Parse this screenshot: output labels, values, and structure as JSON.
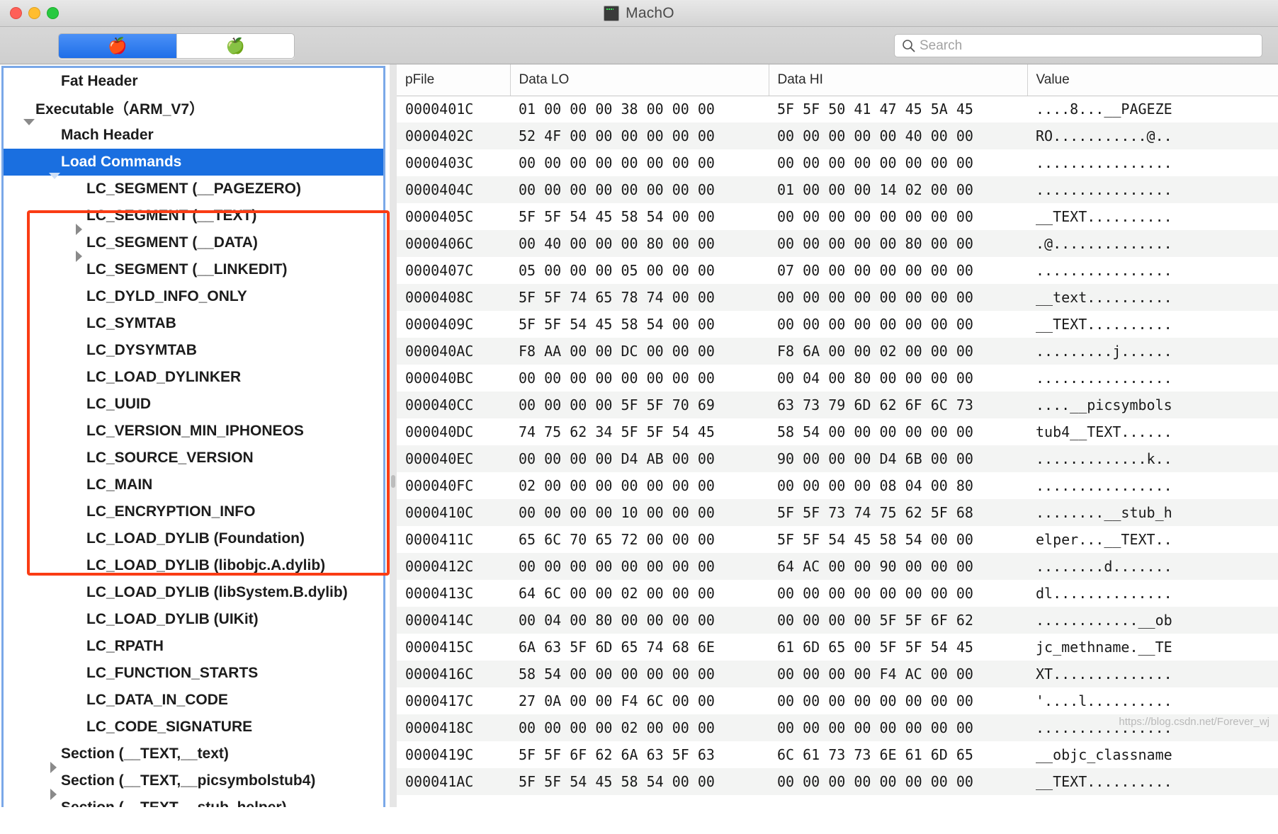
{
  "window": {
    "title": "MachO",
    "app_icon": "terminal-icon",
    "traffic_lights": [
      "close",
      "minimize",
      "zoom"
    ]
  },
  "toolbar": {
    "segments": [
      {
        "icon": "apple-bitten-red-icon",
        "selected": true
      },
      {
        "icon": "apple-bitten-grey-icon",
        "selected": false
      }
    ],
    "search": {
      "placeholder": "Search",
      "value": "",
      "icon": "search-icon"
    }
  },
  "sidebar": {
    "items": [
      {
        "label": "Fat Header",
        "indent": 1,
        "arrow": "none",
        "selected": false
      },
      {
        "label": "Executable（ARM_V7）",
        "indent": 0,
        "arrow": "down",
        "selected": false
      },
      {
        "label": "Mach Header",
        "indent": 1,
        "arrow": "none",
        "selected": false
      },
      {
        "label": "Load Commands",
        "indent": 1,
        "arrow": "down",
        "selected": true
      },
      {
        "label": "LC_SEGMENT (__PAGEZERO)",
        "indent": 2,
        "arrow": "none",
        "selected": false
      },
      {
        "label": "LC_SEGMENT (__TEXT)",
        "indent": 2,
        "arrow": "right",
        "selected": false
      },
      {
        "label": "LC_SEGMENT (__DATA)",
        "indent": 2,
        "arrow": "right",
        "selected": false
      },
      {
        "label": "LC_SEGMENT (__LINKEDIT)",
        "indent": 2,
        "arrow": "none",
        "selected": false
      },
      {
        "label": "LC_DYLD_INFO_ONLY",
        "indent": 2,
        "arrow": "none",
        "selected": false
      },
      {
        "label": "LC_SYMTAB",
        "indent": 2,
        "arrow": "none",
        "selected": false
      },
      {
        "label": "LC_DYSYMTAB",
        "indent": 2,
        "arrow": "none",
        "selected": false
      },
      {
        "label": "LC_LOAD_DYLINKER",
        "indent": 2,
        "arrow": "none",
        "selected": false
      },
      {
        "label": "LC_UUID",
        "indent": 2,
        "arrow": "none",
        "selected": false
      },
      {
        "label": "LC_VERSION_MIN_IPHONEOS",
        "indent": 2,
        "arrow": "none",
        "selected": false
      },
      {
        "label": "LC_SOURCE_VERSION",
        "indent": 2,
        "arrow": "none",
        "selected": false
      },
      {
        "label": "LC_MAIN",
        "indent": 2,
        "arrow": "none",
        "selected": false
      },
      {
        "label": "LC_ENCRYPTION_INFO",
        "indent": 2,
        "arrow": "none",
        "selected": false
      },
      {
        "label": "LC_LOAD_DYLIB (Foundation)",
        "indent": 2,
        "arrow": "none",
        "selected": false
      },
      {
        "label": "LC_LOAD_DYLIB (libobjc.A.dylib)",
        "indent": 2,
        "arrow": "none",
        "selected": false
      },
      {
        "label": "LC_LOAD_DYLIB (libSystem.B.dylib)",
        "indent": 2,
        "arrow": "none",
        "selected": false
      },
      {
        "label": "LC_LOAD_DYLIB (UIKit)",
        "indent": 2,
        "arrow": "none",
        "selected": false
      },
      {
        "label": "LC_RPATH",
        "indent": 2,
        "arrow": "none",
        "selected": false
      },
      {
        "label": "LC_FUNCTION_STARTS",
        "indent": 2,
        "arrow": "none",
        "selected": false
      },
      {
        "label": "LC_DATA_IN_CODE",
        "indent": 2,
        "arrow": "none",
        "selected": false
      },
      {
        "label": "LC_CODE_SIGNATURE",
        "indent": 2,
        "arrow": "none",
        "selected": false
      },
      {
        "label": "Section (__TEXT,__text)",
        "indent": 1,
        "arrow": "right",
        "selected": false
      },
      {
        "label": "Section (__TEXT,__picsymbolstub4)",
        "indent": 1,
        "arrow": "right",
        "selected": false
      },
      {
        "label": "Section (__TEXT,__stub_helper)",
        "indent": 1,
        "arrow": "right",
        "selected": false
      }
    ]
  },
  "hex_table": {
    "columns": [
      "pFile",
      "Data LO",
      "Data HI",
      "Value"
    ],
    "rows": [
      [
        "0000401C",
        "01 00 00 00 38 00 00 00",
        "5F 5F 50 41 47 45 5A 45",
        "....8...__PAGEZE"
      ],
      [
        "0000402C",
        "52 4F 00 00 00 00 00 00",
        "00 00 00 00 00 40 00 00",
        "RO...........@.."
      ],
      [
        "0000403C",
        "00 00 00 00 00 00 00 00",
        "00 00 00 00 00 00 00 00",
        "................"
      ],
      [
        "0000404C",
        "00 00 00 00 00 00 00 00",
        "01 00 00 00 14 02 00 00",
        "................"
      ],
      [
        "0000405C",
        "5F 5F 54 45 58 54 00 00",
        "00 00 00 00 00 00 00 00",
        "__TEXT.........."
      ],
      [
        "0000406C",
        "00 40 00 00 00 80 00 00",
        "00 00 00 00 00 80 00 00",
        ".@.............."
      ],
      [
        "0000407C",
        "05 00 00 00 05 00 00 00",
        "07 00 00 00 00 00 00 00",
        "................"
      ],
      [
        "0000408C",
        "5F 5F 74 65 78 74 00 00",
        "00 00 00 00 00 00 00 00",
        "__text.........."
      ],
      [
        "0000409C",
        "5F 5F 54 45 58 54 00 00",
        "00 00 00 00 00 00 00 00",
        "__TEXT.........."
      ],
      [
        "000040AC",
        "F8 AA 00 00 DC 00 00 00",
        "F8 6A 00 00 02 00 00 00",
        ".........j......"
      ],
      [
        "000040BC",
        "00 00 00 00 00 00 00 00",
        "00 04 00 80 00 00 00 00",
        "................"
      ],
      [
        "000040CC",
        "00 00 00 00 5F 5F 70 69",
        "63 73 79 6D 62 6F 6C 73",
        "....__picsymbols"
      ],
      [
        "000040DC",
        "74 75 62 34 5F 5F 54 45",
        "58 54 00 00 00 00 00 00",
        "tub4__TEXT......"
      ],
      [
        "000040EC",
        "00 00 00 00 D4 AB 00 00",
        "90 00 00 00 D4 6B 00 00",
        ".............k.."
      ],
      [
        "000040FC",
        "02 00 00 00 00 00 00 00",
        "00 00 00 00 08 04 00 80",
        "................"
      ],
      [
        "0000410C",
        "00 00 00 00 10 00 00 00",
        "5F 5F 73 74 75 62 5F 68",
        "........__stub_h"
      ],
      [
        "0000411C",
        "65 6C 70 65 72 00 00 00",
        "5F 5F 54 45 58 54 00 00",
        "elper...__TEXT.."
      ],
      [
        "0000412C",
        "00 00 00 00 00 00 00 00",
        "64 AC 00 00 90 00 00 00",
        "........d......."
      ],
      [
        "0000413C",
        "64 6C 00 00 02 00 00 00",
        "00 00 00 00 00 00 00 00",
        "dl.............."
      ],
      [
        "0000414C",
        "00 04 00 80 00 00 00 00",
        "00 00 00 00 5F 5F 6F 62",
        "............__ob"
      ],
      [
        "0000415C",
        "6A 63 5F 6D 65 74 68 6E",
        "61 6D 65 00 5F 5F 54 45",
        "jc_methname.__TE"
      ],
      [
        "0000416C",
        "58 54 00 00 00 00 00 00",
        "00 00 00 00 F4 AC 00 00",
        "XT.............."
      ],
      [
        "0000417C",
        "27 0A 00 00 F4 6C 00 00",
        "00 00 00 00 00 00 00 00",
        "'....l.........."
      ],
      [
        "0000418C",
        "00 00 00 00 02 00 00 00",
        "00 00 00 00 00 00 00 00",
        "................"
      ],
      [
        "0000419C",
        "5F 5F 6F 62 6A 63 5F 63",
        "6C 61 73 73 6E 61 6D 65",
        "__objc_classname"
      ],
      [
        "000041AC",
        "5F 5F 54 45 58 54 00 00",
        "00 00 00 00 00 00 00 00",
        "__TEXT.........."
      ]
    ]
  },
  "watermark": "https://blog.csdn.net/Forever_wj"
}
